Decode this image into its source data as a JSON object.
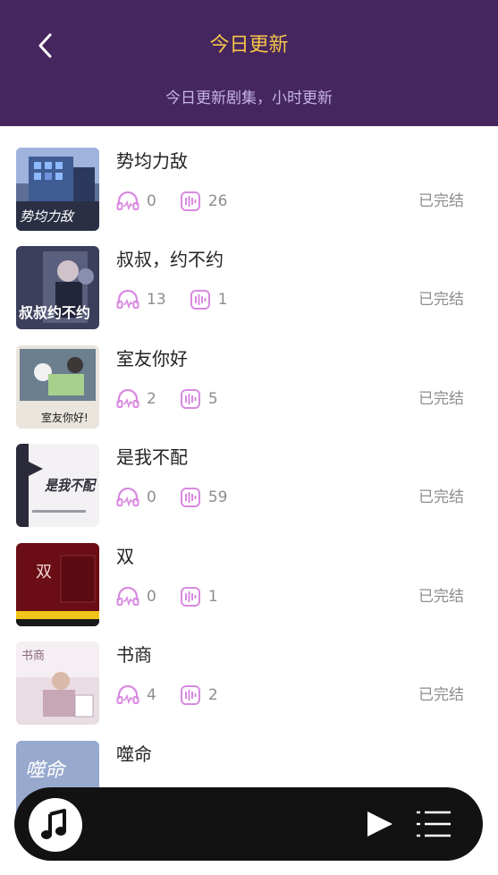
{
  "header": {
    "title": "今日更新",
    "subtitle": "今日更新剧集，小时更新",
    "back_icon": "chevron-left-icon"
  },
  "colors": {
    "header_bg": "#46265f",
    "title": "#f6c54a",
    "subtitle": "#c4b3e6",
    "stat_icon": "#d88ae0",
    "player_bg": "#121212"
  },
  "items": [
    {
      "title": "势均力敌",
      "listens": "0",
      "episodes": "26",
      "status": "已完结",
      "cover_text": "势均力敌"
    },
    {
      "title": "叔叔，约不约",
      "listens": "13",
      "episodes": "1",
      "status": "已完结",
      "cover_text": "叔叔约不约"
    },
    {
      "title": "室友你好",
      "listens": "2",
      "episodes": "5",
      "status": "已完结",
      "cover_text": "室友你好!"
    },
    {
      "title": "是我不配",
      "listens": "0",
      "episodes": "59",
      "status": "已完结",
      "cover_text": "是我不配"
    },
    {
      "title": "双",
      "listens": "0",
      "episodes": "1",
      "status": "已完结",
      "cover_text": "双"
    },
    {
      "title": "书商",
      "listens": "4",
      "episodes": "2",
      "status": "已完结",
      "cover_text": "书商"
    },
    {
      "title": "噬命",
      "listens": "",
      "episodes": "",
      "status": "",
      "cover_text": "噬命"
    }
  ],
  "player": {
    "music_icon": "music-note-icon",
    "play_icon": "play-icon",
    "playlist_icon": "playlist-icon"
  }
}
